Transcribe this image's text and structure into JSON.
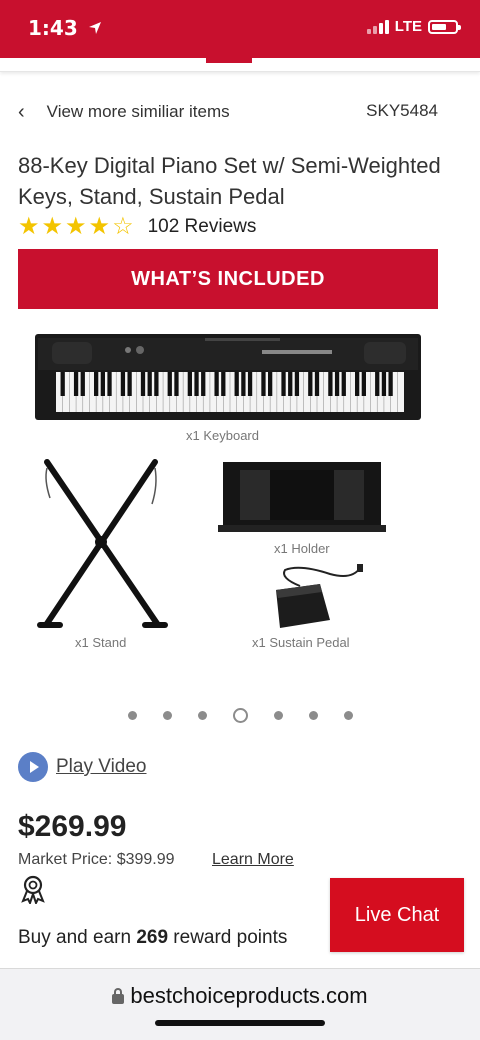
{
  "status": {
    "time": "1:43",
    "network": "LTE",
    "location_icon": "location-arrow-icon"
  },
  "breadcrumb": {
    "back_icon": "chevron-left-icon",
    "label": "View more similiar items",
    "sku": "SKY5484"
  },
  "product": {
    "title": "88-Key Digital Piano Set w/ Semi-Weighted Keys, Stand, Sustain Pedal",
    "rating": 4,
    "rating_max": 5,
    "reviews": "102 Reviews"
  },
  "included": {
    "banner": "WHAT’S INCLUDED",
    "captions": {
      "keyboard": "x1 Keyboard",
      "stand": "x1 Stand",
      "holder": "x1 Holder",
      "pedal": "x1 Sustain Pedal"
    }
  },
  "carousel": {
    "count": 7,
    "active_index": 3
  },
  "video": {
    "label": "Play Video"
  },
  "pricing": {
    "price": "$269.99",
    "market": "Market Price: $399.99",
    "learn_more": "Learn More"
  },
  "rewards": {
    "prefix": "Buy and earn",
    "points": "269",
    "suffix": "reward points"
  },
  "chat": {
    "label": "Live Chat"
  },
  "browser": {
    "url": "bestchoiceproducts.com"
  },
  "colors": {
    "brand_red": "#c8102e",
    "chat_red": "#d50d1f",
    "star": "#f3c400",
    "play_blue": "#5b7fc7"
  }
}
